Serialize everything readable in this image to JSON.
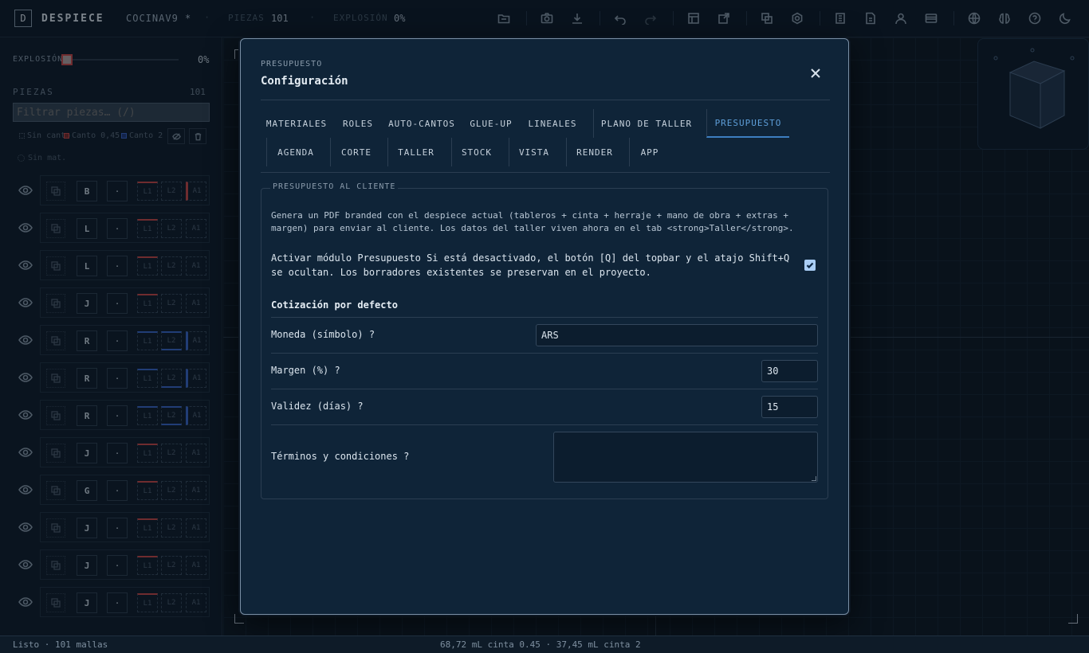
{
  "topbar": {
    "logo_letter": "D",
    "brand": "DESPIECE",
    "project": "COCINAV9 *",
    "pieces_label": "PIEZAS",
    "pieces_value": "101",
    "explosion_label": "EXPLOSIÓN",
    "explosion_value": "0%",
    "icons": [
      "folder-icon",
      "camera-icon",
      "download-icon",
      "undo-icon",
      "redo-icon",
      "cut-list-icon",
      "export-icon",
      "layers-icon",
      "gear-icon",
      "book-icon",
      "document-icon",
      "user-icon",
      "card-icon",
      "globe-icon",
      "brain-icon",
      "help-icon",
      "moon-icon"
    ]
  },
  "sidebar": {
    "explosion_label": "EXPLOSIÓN",
    "explosion_value": "0%",
    "explosion_level": 0,
    "pieces_label": "PIEZAS",
    "pieces_count": "101",
    "filter_placeholder": "Filtrar piezas… (/)",
    "legend": [
      "Sin canto",
      "Canto 0,45",
      "Canto 2"
    ],
    "sin_mat": "Sin mat.",
    "rows": [
      {
        "letter": "B",
        "dot": "·",
        "l1": "L1",
        "l2": "L2",
        "a1": "A1"
      },
      {
        "letter": "L",
        "dot": "·",
        "l1": "L1",
        "l2": "L2",
        "a1": "A1"
      },
      {
        "letter": "L",
        "dot": "·",
        "l1": "L1",
        "l2": "L2",
        "a1": "A1"
      },
      {
        "letter": "J",
        "dot": "·",
        "l1": "L1",
        "l2": "L2",
        "a1": "A1"
      },
      {
        "letter": "R",
        "dot": "·",
        "l1": "L1",
        "l2": "L2",
        "a1": "A1"
      },
      {
        "letter": "R",
        "dot": "·",
        "l1": "L1",
        "l2": "L2",
        "a1": "A1"
      },
      {
        "letter": "R",
        "dot": "·",
        "l1": "L1",
        "l2": "L2",
        "a1": "A1"
      },
      {
        "letter": "J",
        "dot": "·",
        "l1": "L1",
        "l2": "L2",
        "a1": "A1"
      },
      {
        "letter": "G",
        "dot": "·",
        "l1": "L1",
        "l2": "L2",
        "a1": "A1"
      },
      {
        "letter": "J",
        "dot": "·",
        "l1": "L1",
        "l2": "L2",
        "a1": "A1"
      },
      {
        "letter": "J",
        "dot": "·",
        "l1": "L1",
        "l2": "L2",
        "a1": "A1"
      },
      {
        "letter": "J",
        "dot": "·",
        "l1": "L1",
        "l2": "L2",
        "a1": "A1"
      }
    ]
  },
  "modal": {
    "subtitle": "PRESUPUESTO",
    "title": "Configuración",
    "tabs_row1": [
      "MATERIALES",
      "ROLES",
      "AUTO-CANTOS",
      "GLUE-UP",
      "LINEALES",
      "PLANO DE TALLER",
      "PRESUPUESTO"
    ],
    "tabs_row2": [
      "AGENDA",
      "CORTE",
      "TALLER",
      "STOCK",
      "VISTA",
      "RENDER",
      "APP"
    ],
    "active_tab": "PRESUPUESTO",
    "section_legend": "PRESUPUESTO AL CLIENTE",
    "description": "Genera un PDF branded con el despiece actual (tableros + cinta + herraje + mano de obra + extras + margen) para enviar al cliente. Los datos del taller viven ahora en el tab <strong>Taller</strong>.",
    "activar_text": "Activar módulo Presupuesto Si está desactivado, el botón [Q] del topbar y el atajo Shift+Q se ocultan. Los borradores existentes se preservan en el proyecto.",
    "activar_checked": true,
    "cotizacion_title": "Cotización por defecto",
    "moneda_label": "Moneda (símbolo) ?",
    "moneda_value": "ARS",
    "margen_label": "Margen (%) ?",
    "margen_value": "30",
    "validez_label": "Validez (días) ?",
    "validez_value": "15",
    "terminos_label": "Términos y condiciones ?",
    "terminos_value": ""
  },
  "statusbar": {
    "left": "Listo · 101 mallas",
    "center": "68,72 mL cinta 0.45 · 37,45 mL cinta 2"
  }
}
